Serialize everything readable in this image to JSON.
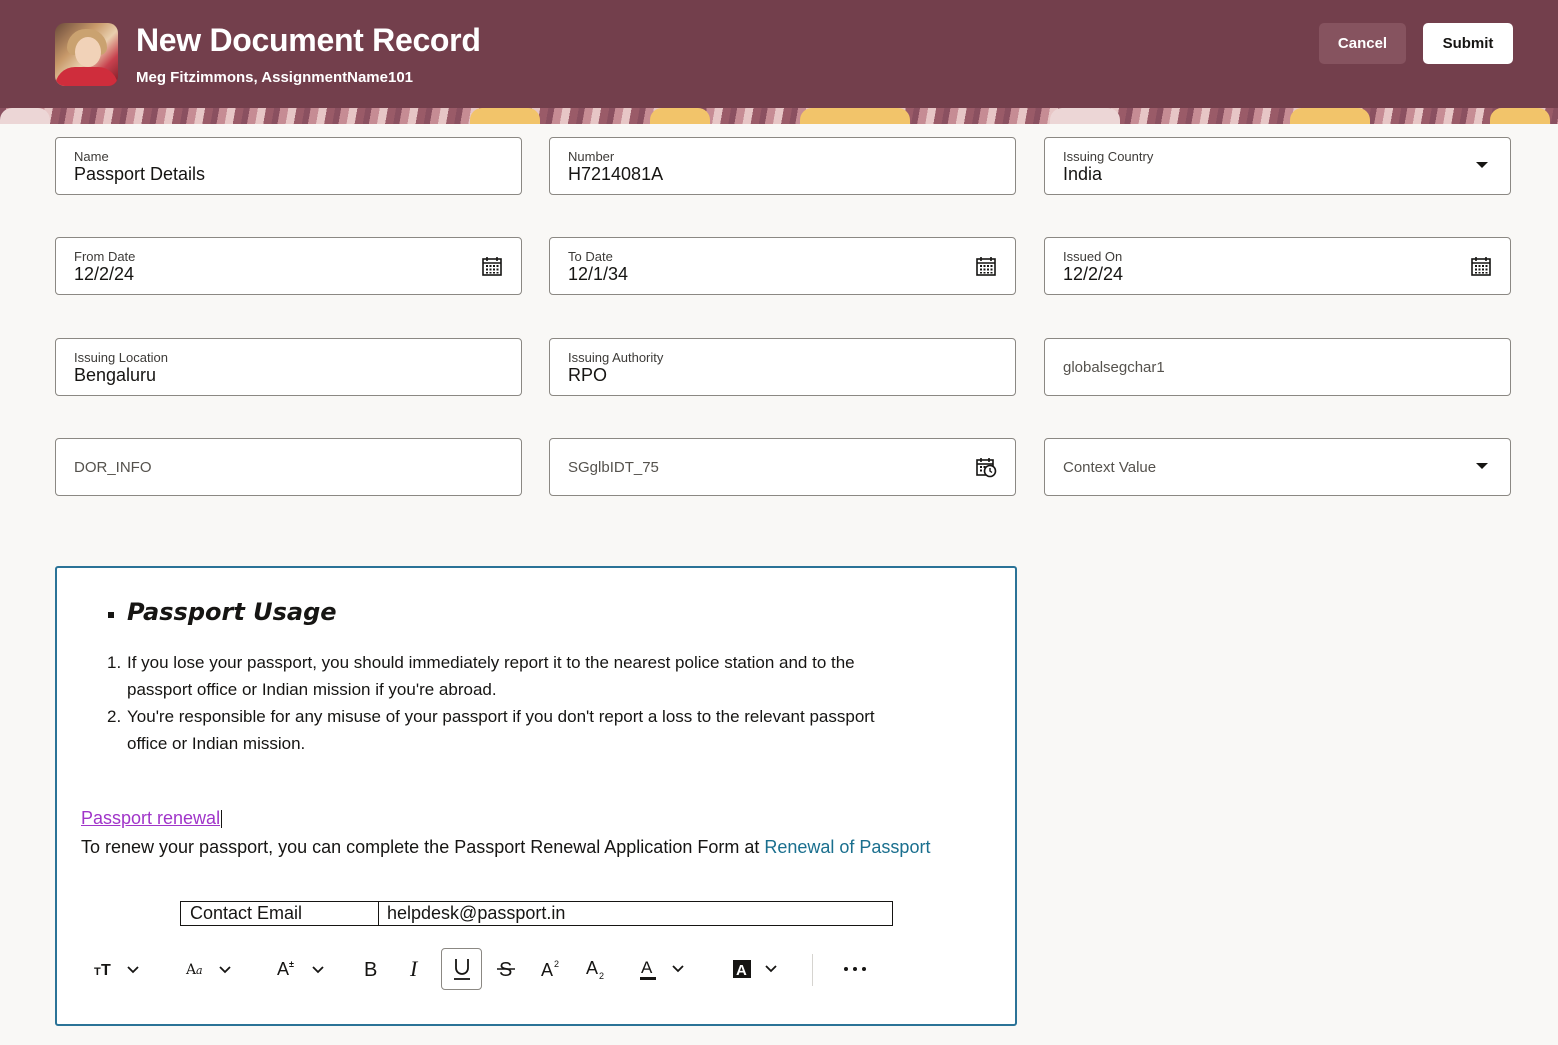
{
  "header": {
    "title": "New Document Record",
    "subtitle": "Meg Fitzimmons, AssignmentName101",
    "cancel_label": "Cancel",
    "submit_label": "Submit",
    "bg_color": "#733f4c"
  },
  "fields": {
    "name": {
      "label": "Name",
      "value": "Passport Details"
    },
    "number": {
      "label": "Number",
      "value": "H7214081A"
    },
    "issuing_country": {
      "label": "Issuing Country",
      "value": "India"
    },
    "from_date": {
      "label": "From Date",
      "value": "12/2/24"
    },
    "to_date": {
      "label": "To Date",
      "value": "12/1/34"
    },
    "issued_on": {
      "label": "Issued On",
      "value": "12/2/24"
    },
    "issuing_location": {
      "label": "Issuing Location",
      "value": "Bengaluru"
    },
    "issuing_authority": {
      "label": "Issuing Authority",
      "value": "RPO"
    },
    "globalsegchar1": {
      "placeholder": "globalsegchar1"
    },
    "dor_info": {
      "placeholder": "DOR_INFO"
    },
    "sgglbldt_75": {
      "placeholder": "SGglbIDT_75"
    },
    "context_value": {
      "placeholder": "Context Value"
    }
  },
  "editor": {
    "heading": "Passport Usage",
    "items": [
      {
        "num": "1.",
        "line1": "If you lose your passport, you should immediately report it to the nearest police station and to the",
        "line2": "passport office or Indian mission if you're abroad."
      },
      {
        "num": "2.",
        "line1": "You're responsible for any misuse of your passport if you don't report a loss to the relevant passport",
        "line2": "office or Indian mission."
      }
    ],
    "link_text": "Passport renewal",
    "para_text": "To renew your passport, you can complete the Passport Renewal Application Form at ",
    "para_link": "Renewal of Passport",
    "table": {
      "key": "Contact Email",
      "value": "helpdesk@passport.in"
    },
    "toolbar_icons": [
      "text-size-icon",
      "font-icon",
      "font-size-icon",
      "bold-icon",
      "italic-icon",
      "underline-icon",
      "strikethrough-icon",
      "superscript-icon",
      "subscript-icon",
      "text-color-icon",
      "highlight-color-icon",
      "more-icon"
    ],
    "border_color": "#2b7397"
  }
}
